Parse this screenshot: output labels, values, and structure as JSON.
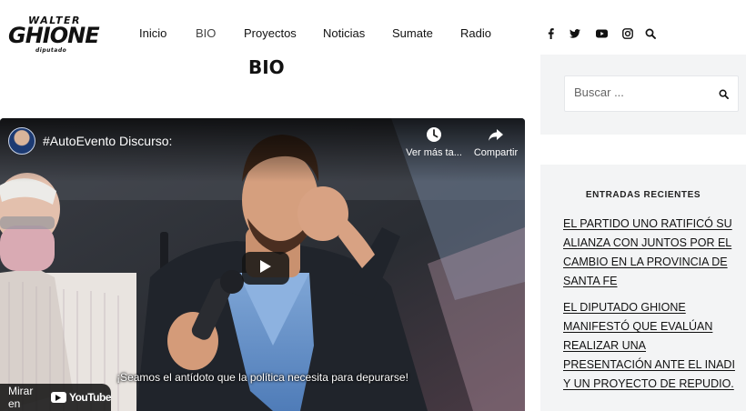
{
  "logo": {
    "top_text": "WALTER",
    "name": "GHIONE",
    "sub_text": "diputado"
  },
  "nav": {
    "items": [
      {
        "label": "Inicio"
      },
      {
        "label": "BIO"
      },
      {
        "label": "Proyectos"
      },
      {
        "label": "Noticias"
      },
      {
        "label": "Sumate"
      },
      {
        "label": "Radio"
      }
    ],
    "current": "BIO"
  },
  "social": {
    "icons": [
      "facebook-icon",
      "twitter-icon",
      "youtube-icon",
      "instagram-icon",
      "search-icon"
    ]
  },
  "page": {
    "title": "BIO"
  },
  "video": {
    "title": "#AutoEvento Discurso:",
    "watch_later_label": "Ver más ta...",
    "share_label": "Compartir",
    "subtitle": "¡Seamos el antídoto que la política necesita para depurarse!",
    "watch_on_label": "Mirar en",
    "youtube_label": "YouTube"
  },
  "sidebar": {
    "search": {
      "placeholder": "Buscar ..."
    },
    "recent": {
      "heading": "ENTRADAS RECIENTES",
      "posts": [
        {
          "title": "EL PARTIDO UNO RATIFICÓ SU ALIANZA CON JUNTOS POR EL CAMBIO EN LA PROVINCIA DE SANTA FE"
        },
        {
          "title": "EL DIPUTADO GHIONE MANIFESTÓ QUE EVALÚAN REALIZAR UNA PRESENTACIÓN ANTE EL INADI Y UN PROYECTO DE REPUDIO."
        }
      ]
    }
  },
  "colors": {
    "sidebar_bg": "#f3f4f5",
    "text": "#111111",
    "youtube_red": "#ff0000"
  }
}
